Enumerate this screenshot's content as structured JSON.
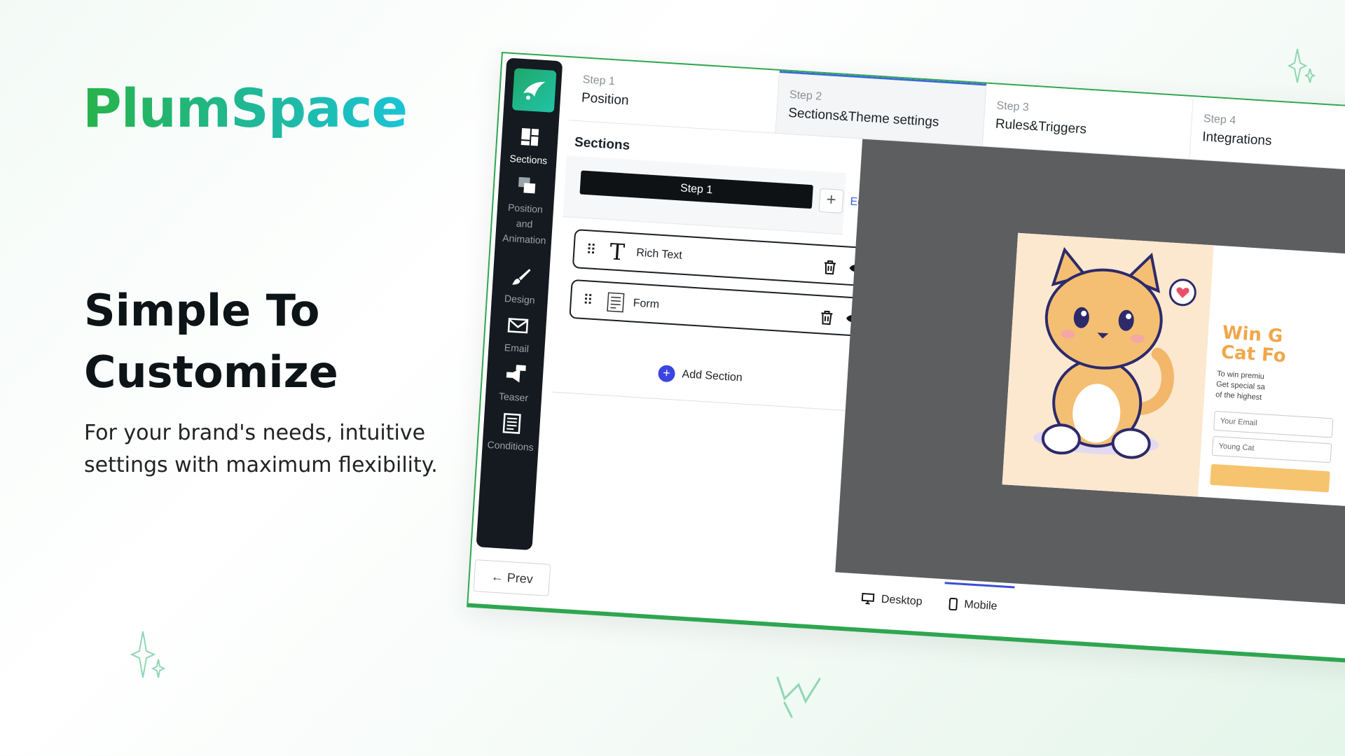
{
  "brand": {
    "name": "PlumSpace",
    "accent_start": "#27b34a",
    "accent_end": "#1ac4d6"
  },
  "hero": {
    "title_line1": "Simple To",
    "title_line2": "Customize",
    "subtitle_line1": "For your brand's needs, intuitive",
    "subtitle_line2": "settings with maximum flexibility."
  },
  "app": {
    "sidebar": {
      "items": [
        {
          "label": "Sections",
          "icon": "sections-icon",
          "active": true
        },
        {
          "label": "Position and Animation",
          "icon": "layers-icon"
        },
        {
          "label": "Design",
          "icon": "brush-icon"
        },
        {
          "label": "Email",
          "icon": "mail-icon"
        },
        {
          "label": "Teaser",
          "icon": "megaphone-icon",
          "badge": "Teaser"
        },
        {
          "label": "Conditions",
          "icon": "document-icon"
        }
      ]
    },
    "steps": [
      {
        "num": "Step 1",
        "name": "Position"
      },
      {
        "num": "Step 2",
        "name": "Sections&Theme settings",
        "active": true
      },
      {
        "num": "Step 3",
        "name": "Rules&Triggers"
      },
      {
        "num": "Step 4",
        "name": "Integrations"
      }
    ],
    "panel": {
      "title": "Sections",
      "step_pill": "Step 1",
      "plus": "+",
      "edit": "Edit ▾",
      "rows": [
        {
          "label": "Rich Text",
          "icon": "T"
        },
        {
          "label": "Form",
          "icon": "form-icon"
        }
      ],
      "add_section": "Add Section"
    },
    "popup": {
      "title_line1": "Win G",
      "title_line2": "Cat Fo",
      "text_line1": "To win premiu",
      "text_line2": "Get special sa",
      "text_line3": "of the highest",
      "email_placeholder": "Your Email",
      "select_value": "Young Cat"
    },
    "footer": {
      "prev": "← Prev",
      "desktop": "Desktop",
      "mobile": "Mobile"
    }
  }
}
